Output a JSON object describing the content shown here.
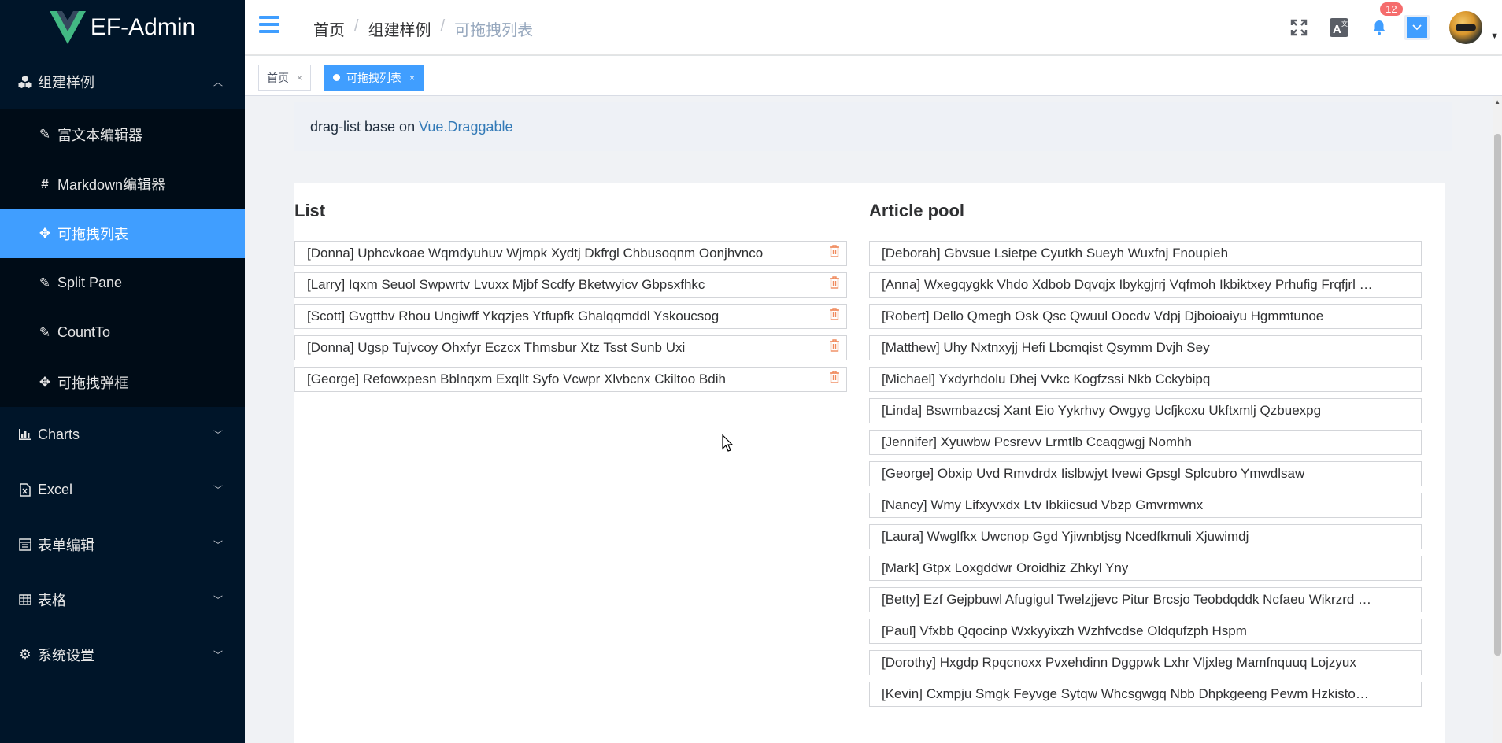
{
  "app": {
    "logo_text": "EF-Admin"
  },
  "sidebar": {
    "items": [
      {
        "label": "组建样例",
        "icon": "components-icon",
        "expanded": true
      },
      {
        "label": "富文本编辑器",
        "icon": "edit-icon"
      },
      {
        "label": "Markdown编辑器",
        "icon": "hash-icon"
      },
      {
        "label": "可拖拽列表",
        "icon": "move-icon",
        "active": true
      },
      {
        "label": "Split Pane",
        "icon": "edit-icon"
      },
      {
        "label": "CountTo",
        "icon": "edit-icon"
      },
      {
        "label": "可拖拽弹框",
        "icon": "move-icon"
      },
      {
        "label": "Charts",
        "icon": "bar-chart-icon"
      },
      {
        "label": "Excel",
        "icon": "file-excel-icon"
      },
      {
        "label": "表单编辑",
        "icon": "form-icon"
      },
      {
        "label": "表格",
        "icon": "table-icon"
      },
      {
        "label": "系统设置",
        "icon": "gear-icon"
      }
    ]
  },
  "header": {
    "breadcrumb": [
      "首页",
      "组建样例",
      "可拖拽列表"
    ],
    "notification_count": "12"
  },
  "tags": [
    {
      "label": "首页",
      "active": false
    },
    {
      "label": "可拖拽列表",
      "active": true
    }
  ],
  "intro": {
    "text": "drag-list base on",
    "link": "Vue.Draggable"
  },
  "list": {
    "title": "List",
    "items": [
      "[Donna] Uphcvkoae Wqmdyuhuv Wjmpk Xydtj Dkfrgl Chbusoqnm Oonjhvnco",
      "[Larry] Iqxm Seuol Swpwrtv Lvuxx Mjbf Scdfy Bketwyicv Gbpsxfhkc",
      "[Scott] Gvgttbv Rhou Ungiwff Ykqzjes Ytfupfk Ghalqqmddl Yskoucsog",
      "[Donna] Ugsp Tujvcoy Ohxfyr Eczcx Thmsbur Xtz Tsst Sunb Uxi",
      "[George] Refowxpesn Bblnqxm Exqllt Syfo Vcwpr Xlvbcnx Ckiltoo Bdih"
    ]
  },
  "pool": {
    "title": "Article pool",
    "items": [
      "[Deborah] Gbvsue Lsietpe Cyutkh Sueyh Wuxfnj Fnoupieh",
      "[Anna] Wxegqygkk Vhdo Xdbob Dqvqjx Ibykgjrrj Vqfmoh Ikbiktxey Prhufig Frqfjrl …",
      "[Robert] Dello Qmegh Osk Qsc Qwuul Oocdv Vdpj Djboioaiyu Hgmmtunoe",
      "[Matthew] Uhy Nxtnxyjj Hefi Lbcmqist Qsymm Dvjh Sey",
      "[Michael] Yxdyrhdolu Dhej Vvkc Kogfzssi Nkb Cckybipq",
      "[Linda] Bswmbazcsj Xant Eio Yykrhvy Owgyg Ucfjkcxu Ukftxmlj Qzbuexpg",
      "[Jennifer] Xyuwbw Pcsrevv Lrmtlb Ccaqgwgj Nomhh",
      "[George] Obxip Uvd Rmvdrdx Iislbwjyt Ivewi Gpsgl Splcubro Ymwdlsaw",
      "[Nancy] Wmy Lifxyvxdx Ltv Ibkiicsud Vbzp Gmvrmwnx",
      "[Laura] Wwglfkx Uwcnop Ggd Yjiwnbtjsg Ncedfkmuli Xjuwimdj",
      "[Mark] Gtpx Loxgddwr Oroidhiz Zhkyl Yny",
      "[Betty] Ezf Gejpbuwl Afugigul Twelzjjevc Pitur Brcsjo Teobdqddk Ncfaeu Wikrzrd …",
      "[Paul] Vfxbb Qqocinp Wxkyyixzh Wzhfvcdse Oldqufzph Hspm",
      "[Dorothy] Hxgdp Rpqcnoxx Pvxehdinn Dggpwk Lxhr Vljxleg Mamfnquuq Lojzyux",
      "[Kevin] Cxmpju Smgk Feyvge Sytqw Whcsgwgq Nbb Dhpkgeeng Pewm Hzkisto…"
    ]
  },
  "colors": {
    "sidebar_bg": "#001529",
    "sidebar_active": "#409eff",
    "accent": "#409eff",
    "badge": "#f56c6c",
    "trash": "#f08a5d"
  }
}
